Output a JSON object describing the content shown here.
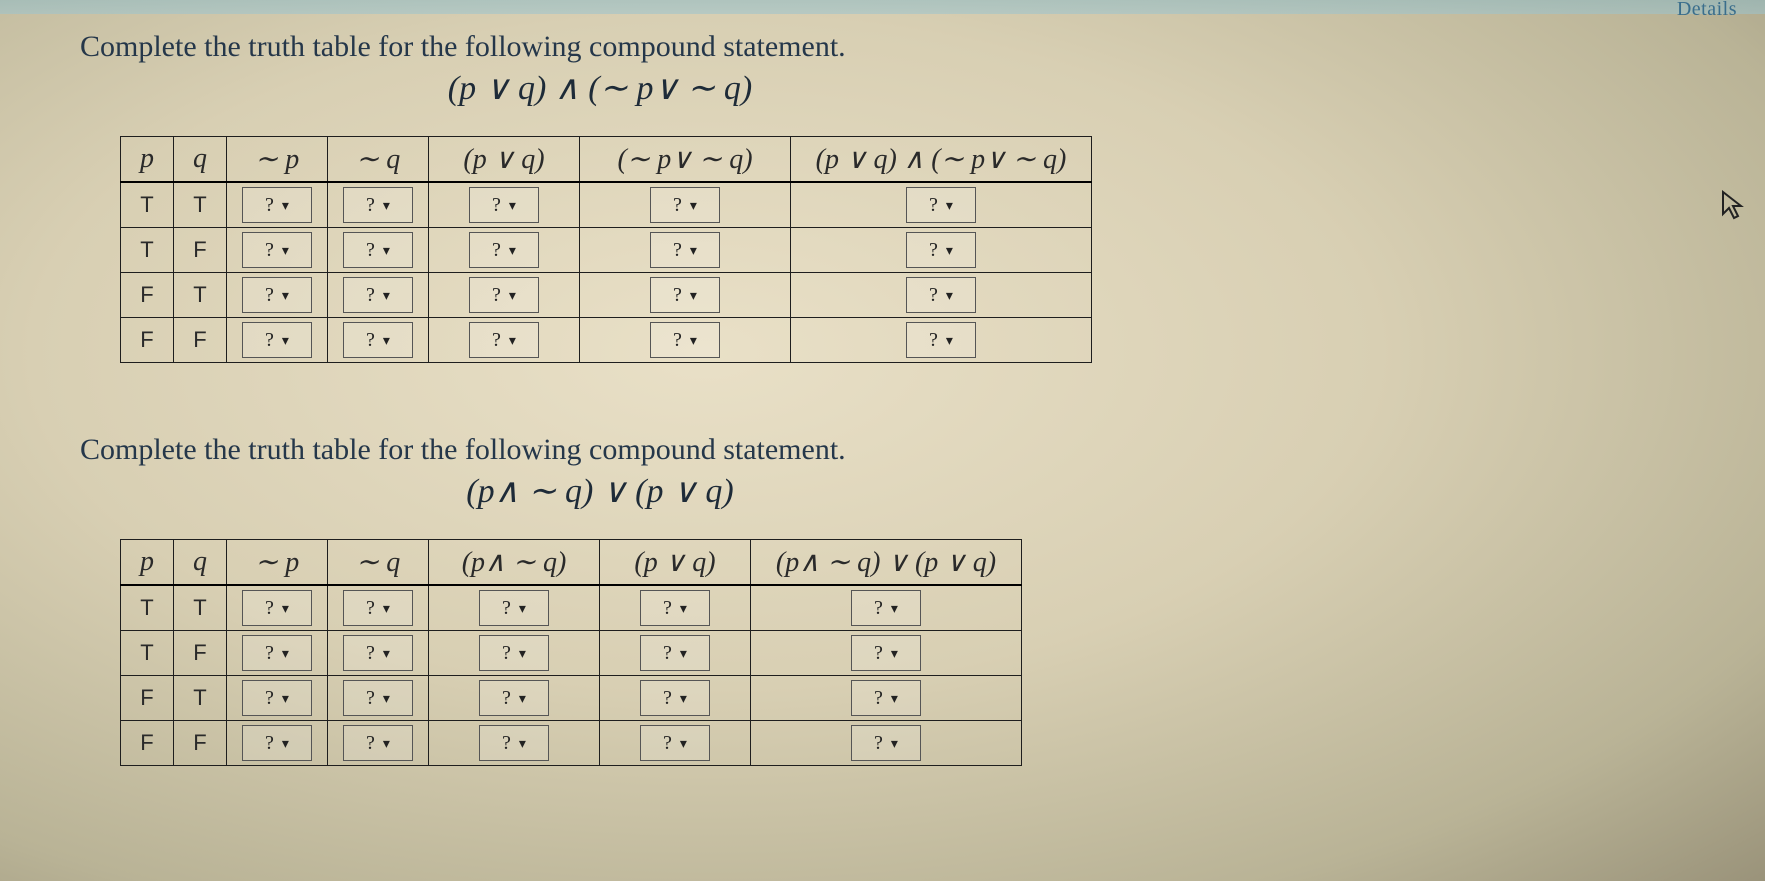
{
  "header": {
    "details_label": "Details"
  },
  "dropdown_placeholder": "?",
  "problem1": {
    "prompt": "Complete the truth table for the following compound statement.",
    "formula": "(p ∨ q) ∧ (∼ p∨ ∼ q)",
    "headers": [
      "p",
      "q",
      "∼ p",
      "∼ q",
      "(p ∨ q)",
      "(∼ p∨ ∼ q)",
      "(p ∨ q) ∧ (∼ p∨ ∼ q)"
    ],
    "rows": [
      {
        "p": "T",
        "q": "T"
      },
      {
        "p": "T",
        "q": "F"
      },
      {
        "p": "F",
        "q": "T"
      },
      {
        "p": "F",
        "q": "F"
      }
    ]
  },
  "problem2": {
    "prompt": "Complete the truth table for the following compound statement.",
    "formula": "(p∧ ∼ q) ∨ (p ∨ q)",
    "headers": [
      "p",
      "q",
      "∼ p",
      "∼ q",
      "(p∧ ∼ q)",
      "(p ∨ q)",
      "(p∧ ∼ q) ∨ (p ∨ q)"
    ],
    "rows": [
      {
        "p": "T",
        "q": "T"
      },
      {
        "p": "T",
        "q": "F"
      },
      {
        "p": "F",
        "q": "T"
      },
      {
        "p": "F",
        "q": "F"
      }
    ]
  }
}
